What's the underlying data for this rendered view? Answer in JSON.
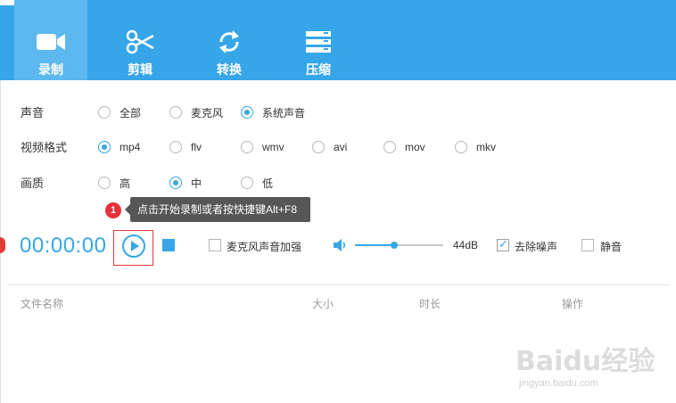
{
  "nav": {
    "items": [
      {
        "label": "录制",
        "icon": "video-camera-icon",
        "active": true
      },
      {
        "label": "剪辑",
        "icon": "scissors-icon",
        "active": false
      },
      {
        "label": "转换",
        "icon": "convert-icon",
        "active": false
      },
      {
        "label": "压缩",
        "icon": "compress-icon",
        "active": false
      }
    ]
  },
  "settings": {
    "audio": {
      "label": "声音",
      "options": [
        {
          "text": "全部",
          "selected": false
        },
        {
          "text": "麦克风",
          "selected": false
        },
        {
          "text": "系统声音",
          "selected": true
        }
      ]
    },
    "format": {
      "label": "视频格式",
      "options": [
        {
          "text": "mp4",
          "selected": true
        },
        {
          "text": "flv",
          "selected": false
        },
        {
          "text": "wmv",
          "selected": false
        },
        {
          "text": "avi",
          "selected": false
        },
        {
          "text": "mov",
          "selected": false
        },
        {
          "text": "mkv",
          "selected": false
        }
      ]
    },
    "quality": {
      "label": "画质",
      "options": [
        {
          "text": "高",
          "selected": false
        },
        {
          "text": "中",
          "selected": true
        },
        {
          "text": "低",
          "selected": false
        }
      ]
    }
  },
  "tooltip": {
    "badge": "1",
    "text": "点击开始录制或者按快捷键Alt+F8"
  },
  "controls": {
    "timer": "00:00:00",
    "mic_boost": {
      "label": "麦克风声音加强",
      "checked": false
    },
    "volume_level": 0.44,
    "volume_text": "44dB",
    "denoise": {
      "label": "去除噪声",
      "checked": true
    },
    "mute": {
      "label": "静音",
      "checked": false
    }
  },
  "table": {
    "headers": [
      "文件名称",
      "大小",
      "时长",
      "操作"
    ]
  },
  "watermark": {
    "text": "Baidu经验",
    "url": "jingyan.baidu.com"
  },
  "colors": {
    "accent": "#36a6e8",
    "nav_active": "#5cb8ef",
    "highlight_red": "#e23a3a",
    "tooltip_bg": "#565656"
  }
}
